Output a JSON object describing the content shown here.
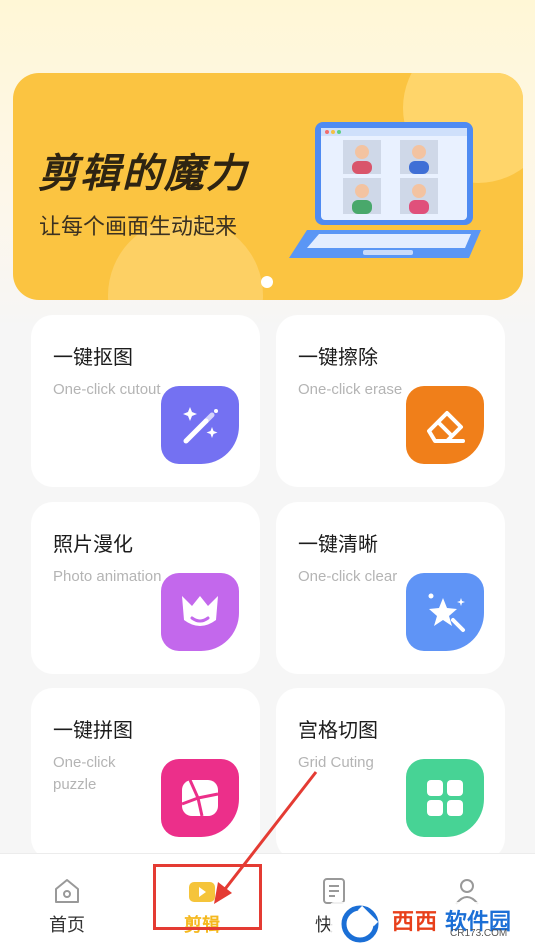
{
  "banner": {
    "title": "剪辑的魔力",
    "subtitle": "让每个画面生动起来"
  },
  "tools": [
    {
      "title": "一键抠图",
      "subtitle": "One-click cutout",
      "icon": "magic-wand-icon",
      "color": "#7471f2"
    },
    {
      "title": "一键擦除",
      "subtitle": "One-click erase",
      "icon": "eraser-icon",
      "color": "#f07f1a"
    },
    {
      "title": "照片漫化",
      "subtitle": "Photo animation",
      "icon": "cartoon-face-icon",
      "color": "#c368ec"
    },
    {
      "title": "一键清晰",
      "subtitle": "One-click clear",
      "icon": "sparkle-star-icon",
      "color": "#5f94f6"
    },
    {
      "title": "一键拼图",
      "subtitle": "One-click puzzle",
      "icon": "puzzle-collage-icon",
      "color": "#ec2f8a"
    },
    {
      "title": "宫格切图",
      "subtitle": "Grid Cuting",
      "icon": "grid-icon",
      "color": "#47d395"
    }
  ],
  "nav": {
    "home": "首页",
    "edit": "剪辑",
    "quick": "快",
    "active": "剪辑"
  },
  "watermark": {
    "brand_red": "西西",
    "brand_blue": "软件园",
    "url": "CR173.COM"
  },
  "colors": {
    "accent": "#fbc441",
    "active_nav": "#f5b81e",
    "annotation": "#e43b33"
  }
}
